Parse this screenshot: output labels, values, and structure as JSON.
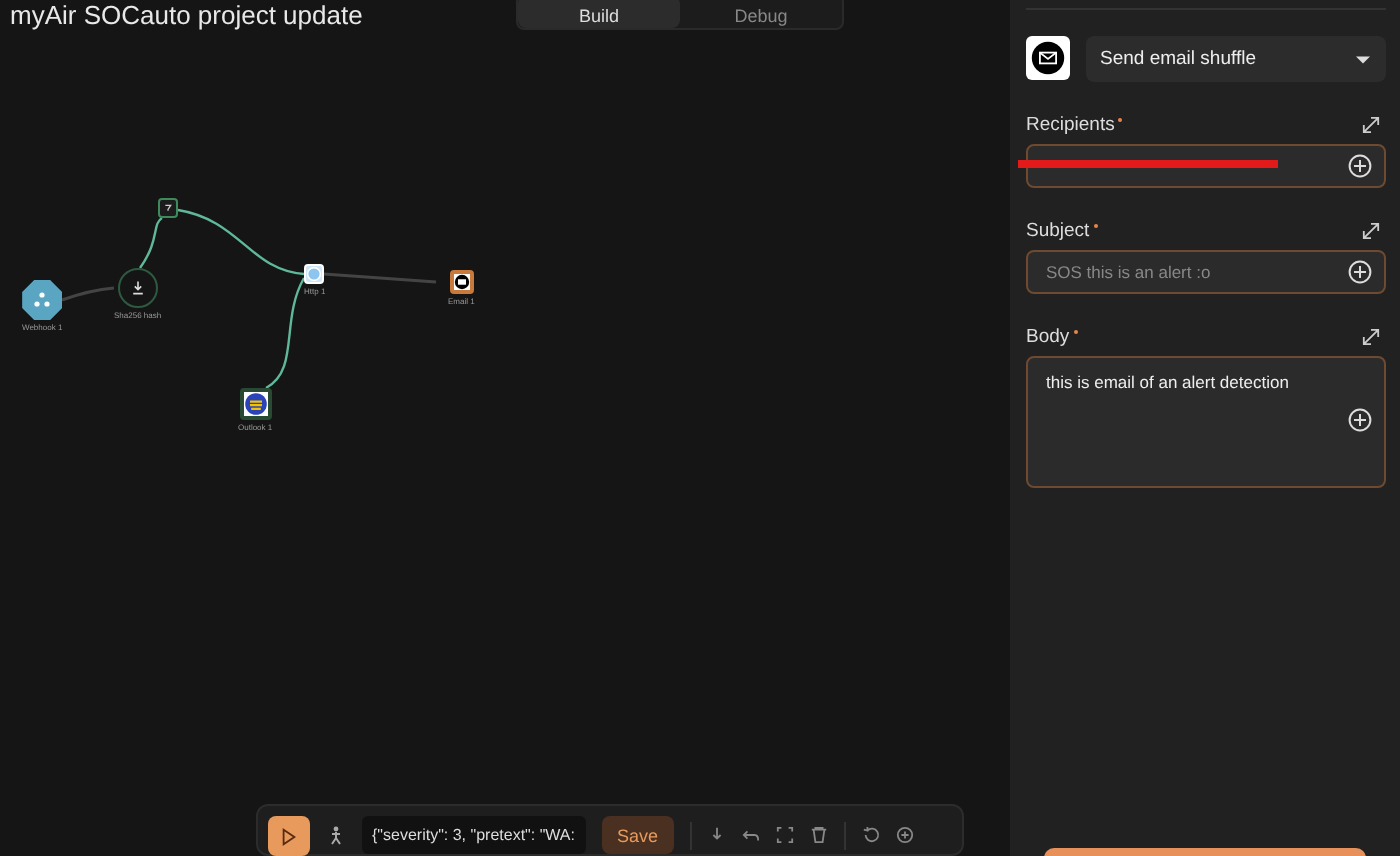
{
  "title": "myAir SOCauto project update",
  "top_tabs": [
    {
      "label": "Build",
      "selected": true
    },
    {
      "label": "Debug",
      "selected": false
    }
  ],
  "nodes": [
    {
      "kind": "webhook",
      "label": "Webhook 1"
    },
    {
      "kind": "hash",
      "label": "Sha256 hash"
    },
    {
      "kind": "condition"
    },
    {
      "kind": "http",
      "label": "Http 1"
    },
    {
      "kind": "email",
      "label": "Email 1"
    },
    {
      "kind": "app",
      "label": "Outlook 1"
    }
  ],
  "toolbar": {
    "code": "{\"severity\": 3, \"pretext\": \"WA:",
    "save": "Save"
  },
  "panel": {
    "action": "Send email shuffle",
    "fields": [
      {
        "label": "Recipients",
        "required": true,
        "redacted": true,
        "multiline": false
      },
      {
        "label": "Subject",
        "required": true,
        "placeholder": "SOS this is an alert :o",
        "multiline": false
      },
      {
        "label": "Body",
        "required": true,
        "value": "this is email of an alert detection",
        "multiline": true
      }
    ]
  }
}
